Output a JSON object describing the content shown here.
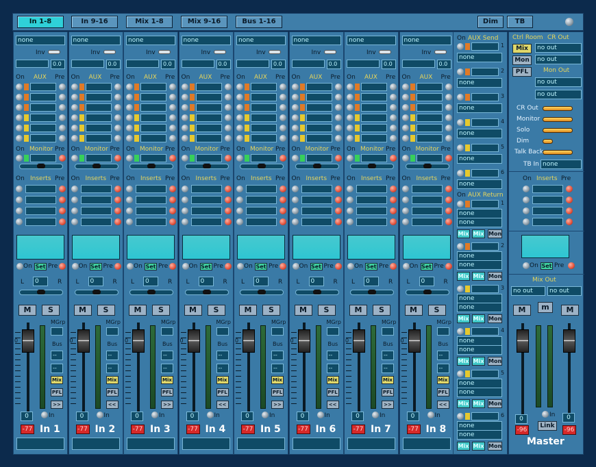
{
  "tabs": [
    {
      "label": "In 1-8",
      "active": true
    },
    {
      "label": "In 9-16"
    },
    {
      "label": "Mix 1-8"
    },
    {
      "label": "Mix 9-16"
    },
    {
      "label": "Bus 1-16"
    }
  ],
  "right_tabs": [
    "Dim",
    "TB"
  ],
  "common": {
    "none": "none",
    "inv": "Inv",
    "on": "On",
    "pre": "Pre",
    "aux": "AUX",
    "monitor": "Monitor",
    "inserts": "Inserts",
    "set": "Set",
    "in": "In",
    "l": "L",
    "r": "R",
    "m": "M",
    "s": "S",
    "mgrp": "MGrp",
    "bus": "Bus",
    "dash": "--",
    "mix": "Mix",
    "pfl": "PFL",
    "ff": ">>",
    "rw": "<<",
    "gain": "0.0",
    "pan": "0",
    "level": "0",
    "peak": "-77"
  },
  "channels": [
    {
      "name": "In 1",
      "arrow": ">>"
    },
    {
      "name": "In 2",
      "arrow": "<<"
    },
    {
      "name": "In 3",
      "arrow": ">>"
    },
    {
      "name": "In 4",
      "arrow": "<<"
    },
    {
      "name": "In 5",
      "arrow": ">>"
    },
    {
      "name": "In 6",
      "arrow": "<<"
    },
    {
      "name": "In 7",
      "arrow": ">>"
    },
    {
      "name": "In 8",
      "arrow": "<<"
    }
  ],
  "aux_send": {
    "title": "AUX Send",
    "on": "On",
    "field": "none",
    "rows": [
      "1",
      "2",
      "3",
      "4",
      "5",
      "6"
    ]
  },
  "aux_return": {
    "title": "AUX Return",
    "on": "On",
    "fields": [
      "none",
      "none"
    ],
    "mix": "Mix",
    "mon": "Mon",
    "rows": [
      "1",
      "2",
      "3",
      "4",
      "5",
      "6"
    ]
  },
  "ctrl_room": {
    "title_left": "Ctrl Room",
    "title_right": "CR Out",
    "mix": "Mix",
    "mon": "Mon",
    "pfl": "PFL",
    "mon_out": "Mon Out",
    "outs": [
      "no out",
      "no out",
      "no out",
      "no out"
    ],
    "levels": [
      {
        "label": "CR Out",
        "level": 1.0
      },
      {
        "label": "Monitor",
        "level": 1.0
      },
      {
        "label": "Solo",
        "level": 1.0
      },
      {
        "label": "Dim",
        "level": 0.35
      },
      {
        "label": "Talk Back",
        "level": 1.0
      }
    ],
    "tb_in_label": "TB In",
    "tb_in": "none"
  },
  "master": {
    "inserts": "Inserts",
    "on": "On",
    "pre": "Pre",
    "set": "Set",
    "mix_out": "Mix Out",
    "outs": [
      "no out",
      "no out"
    ],
    "m": "M",
    "small_m": "m",
    "link": "Link",
    "in": "In",
    "levels": [
      "0",
      "0"
    ],
    "peaks": [
      "-96",
      "-96"
    ],
    "name": "Master"
  }
}
